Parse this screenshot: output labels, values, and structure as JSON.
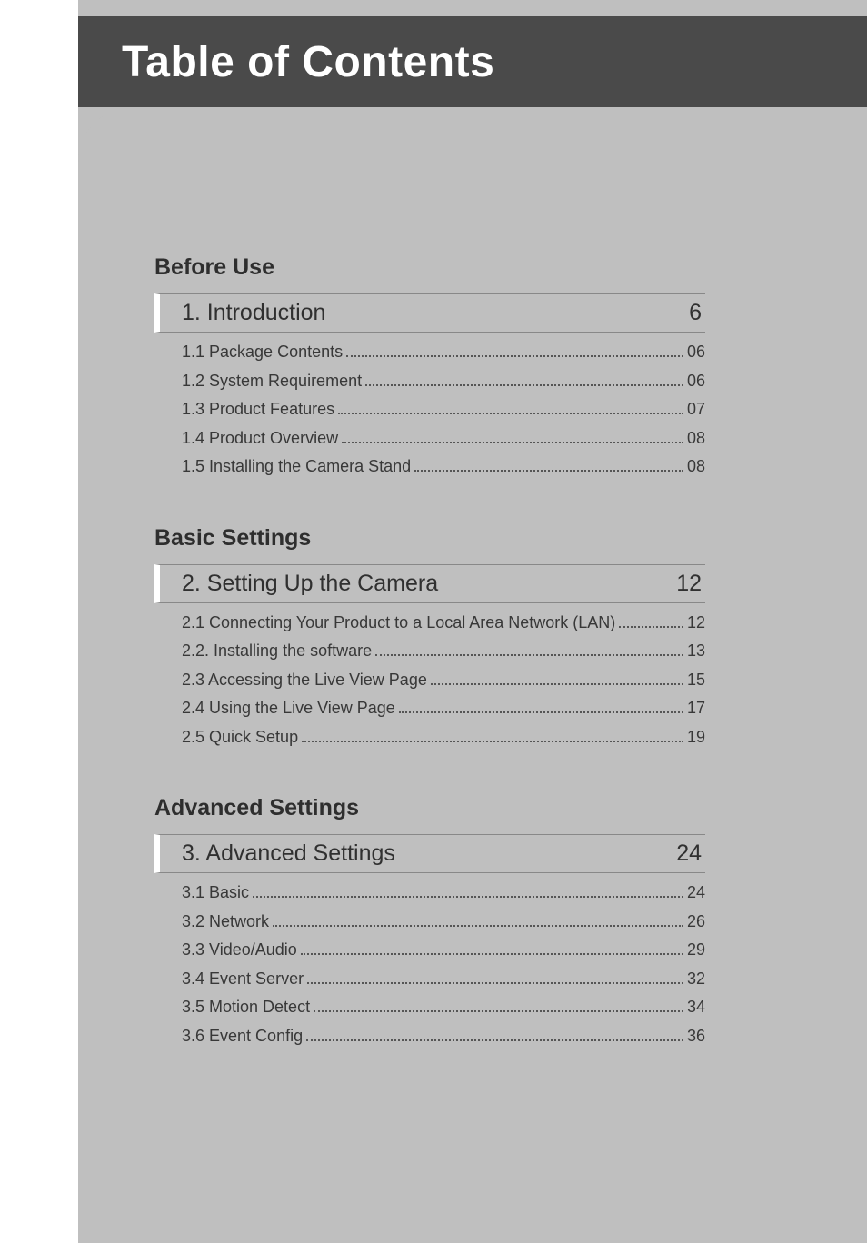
{
  "header": {
    "title": "Table of Contents"
  },
  "sections": [
    {
      "label": "Before Use",
      "chapter_title": "1. Introduction",
      "chapter_page": "6",
      "entries": [
        {
          "label": "1.1 Package Contents",
          "page": "06"
        },
        {
          "label": "1.2 System Requirement",
          "page": "06"
        },
        {
          "label": "1.3 Product Features",
          "page": "07"
        },
        {
          "label": "1.4 Product Overview",
          "page": "08"
        },
        {
          "label": "1.5 Installing the Camera Stand",
          "page": "08"
        }
      ]
    },
    {
      "label": "Basic Settings",
      "chapter_title": "2. Setting Up the Camera",
      "chapter_page": "12",
      "entries": [
        {
          "label": "2.1 Connecting Your Product to a Local Area Network (LAN)",
          "page": "12"
        },
        {
          "label": "2.2. Installing the software",
          "page": "13"
        },
        {
          "label": "2.3 Accessing the Live View Page",
          "page": "15"
        },
        {
          "label": "2.4 Using the Live View Page",
          "page": "17"
        },
        {
          "label": "2.5 Quick Setup",
          "page": "19"
        }
      ]
    },
    {
      "label": "Advanced Settings",
      "chapter_title": "3. Advanced Settings",
      "chapter_page": "24",
      "entries": [
        {
          "label": "3.1 Basic",
          "page": "24"
        },
        {
          "label": "3.2 Network",
          "page": "26"
        },
        {
          "label": "3.3 Video/Audio",
          "page": "29"
        },
        {
          "label": "3.4 Event Server",
          "page": "32"
        },
        {
          "label": "3.5 Motion Detect",
          "page": "34"
        },
        {
          "label": "3.6 Event Config",
          "page": "36"
        }
      ]
    }
  ]
}
